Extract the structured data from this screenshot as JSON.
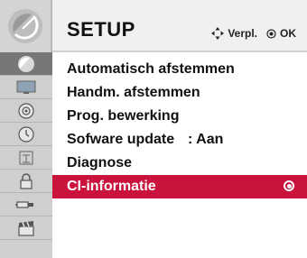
{
  "header": {
    "title": "SETUP",
    "hints": [
      {
        "icon": "dpad-move-icon",
        "label": "Verpl."
      },
      {
        "icon": "ok-button-icon",
        "label": "OK"
      }
    ]
  },
  "category_rail": [
    {
      "icon": "satellite-dish-icon",
      "active": true
    },
    {
      "icon": "tv-picture-icon",
      "active": false
    },
    {
      "icon": "speaker-audio-icon",
      "active": false
    },
    {
      "icon": "clock-time-icon",
      "active": false
    },
    {
      "icon": "lock-option-icon",
      "active": false
    },
    {
      "icon": "padlock-icon",
      "active": false
    },
    {
      "icon": "usb-plug-icon",
      "active": false
    },
    {
      "icon": "clapperboard-icon",
      "active": false
    }
  ],
  "menu": {
    "items": [
      {
        "label": "Automatisch afstemmen",
        "value": ""
      },
      {
        "label": "Handm. afstemmen",
        "value": ""
      },
      {
        "label": "Prog. bewerking",
        "value": ""
      },
      {
        "label": "Sofware update",
        "value": ": Aan"
      },
      {
        "label": "Diagnose",
        "value": ""
      },
      {
        "label": "CI-informatie",
        "value": "",
        "selected": true
      }
    ]
  },
  "colors": {
    "selected_row": "#c9123c",
    "active_rail": "#777777",
    "rail": "#cfcfcf",
    "header": "#f0f0f0"
  }
}
